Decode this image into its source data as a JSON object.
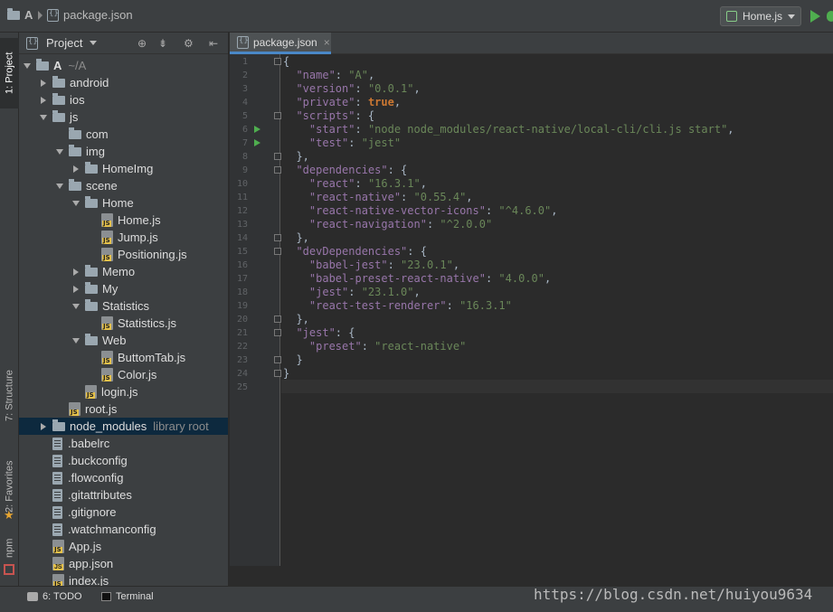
{
  "topbar": {
    "project": "A",
    "file": "package.json",
    "run_config": "Home.js"
  },
  "leftstrip": {
    "tabs": [
      "1: Project",
      "7: Structure",
      "2: Favorites",
      "npm"
    ]
  },
  "project_panel": {
    "title": "Project",
    "tree": [
      {
        "label": "A",
        "extra": "~/A",
        "type": "folder",
        "expanded": true,
        "depth": 0
      },
      {
        "label": "android",
        "type": "folder",
        "expanded": false,
        "depth": 1
      },
      {
        "label": "ios",
        "type": "folder",
        "expanded": false,
        "depth": 1
      },
      {
        "label": "js",
        "type": "folder",
        "expanded": true,
        "depth": 1
      },
      {
        "label": "com",
        "type": "folder",
        "expanded": null,
        "depth": 2
      },
      {
        "label": "img",
        "type": "folder",
        "expanded": true,
        "depth": 2
      },
      {
        "label": "HomeImg",
        "type": "folder",
        "expanded": false,
        "depth": 3
      },
      {
        "label": "scene",
        "type": "folder",
        "expanded": true,
        "depth": 2
      },
      {
        "label": "Home",
        "type": "folder",
        "expanded": true,
        "depth": 3
      },
      {
        "label": "Home.js",
        "type": "js",
        "depth": 4
      },
      {
        "label": "Jump.js",
        "type": "js",
        "depth": 4
      },
      {
        "label": "Positioning.js",
        "type": "js",
        "depth": 4
      },
      {
        "label": "Memo",
        "type": "folder",
        "expanded": false,
        "depth": 3
      },
      {
        "label": "My",
        "type": "folder",
        "expanded": false,
        "depth": 3
      },
      {
        "label": "Statistics",
        "type": "folder",
        "expanded": true,
        "depth": 3
      },
      {
        "label": "Statistics.js",
        "type": "js",
        "depth": 4
      },
      {
        "label": "Web",
        "type": "folder",
        "expanded": true,
        "depth": 3
      },
      {
        "label": "ButtomTab.js",
        "type": "js",
        "depth": 4
      },
      {
        "label": "Color.js",
        "type": "js",
        "depth": 4
      },
      {
        "label": "login.js",
        "type": "js",
        "depth": 3
      },
      {
        "label": "root.js",
        "type": "js",
        "depth": 2
      },
      {
        "label": "node_modules",
        "extra": "library root",
        "type": "folder",
        "expanded": false,
        "depth": 1,
        "selected": true
      },
      {
        "label": ".babelrc",
        "type": "txt",
        "depth": 1
      },
      {
        "label": ".buckconfig",
        "type": "txt",
        "depth": 1
      },
      {
        "label": ".flowconfig",
        "type": "txt",
        "depth": 1
      },
      {
        "label": ".gitattributes",
        "type": "txt",
        "depth": 1
      },
      {
        "label": ".gitignore",
        "type": "txt",
        "depth": 1
      },
      {
        "label": ".watchmanconfig",
        "type": "txt",
        "depth": 1
      },
      {
        "label": "App.js",
        "type": "js",
        "depth": 1
      },
      {
        "label": "app.json",
        "type": "json",
        "depth": 1
      },
      {
        "label": "index.js",
        "type": "js",
        "depth": 1
      }
    ]
  },
  "editor": {
    "tab": "package.json",
    "lines": [
      [
        [
          "p",
          "{"
        ]
      ],
      [
        [
          "k",
          "  \"name\""
        ],
        [
          "p",
          ": "
        ],
        [
          "s",
          "\"A\""
        ],
        [
          "p",
          ","
        ]
      ],
      [
        [
          "k",
          "  \"version\""
        ],
        [
          "p",
          ": "
        ],
        [
          "s",
          "\"0.0.1\""
        ],
        [
          "p",
          ","
        ]
      ],
      [
        [
          "k",
          "  \"private\""
        ],
        [
          "p",
          ": "
        ],
        [
          "b",
          "true"
        ],
        [
          "p",
          ","
        ]
      ],
      [
        [
          "k",
          "  \"scripts\""
        ],
        [
          "p",
          ": {"
        ]
      ],
      [
        [
          "k",
          "    \"start\""
        ],
        [
          "p",
          ": "
        ],
        [
          "s",
          "\"node node_modules/react-native/local-cli/cli.js start\""
        ],
        [
          "p",
          ","
        ]
      ],
      [
        [
          "k",
          "    \"test\""
        ],
        [
          "p",
          ": "
        ],
        [
          "s",
          "\"jest\""
        ]
      ],
      [
        [
          "p",
          "  },"
        ]
      ],
      [
        [
          "k",
          "  \"dependencies\""
        ],
        [
          "p",
          ": {"
        ]
      ],
      [
        [
          "k",
          "    \"react\""
        ],
        [
          "p",
          ": "
        ],
        [
          "s",
          "\"16.3.1\""
        ],
        [
          "p",
          ","
        ]
      ],
      [
        [
          "k",
          "    \"react-native\""
        ],
        [
          "p",
          ": "
        ],
        [
          "s",
          "\"0.55.4\""
        ],
        [
          "p",
          ","
        ]
      ],
      [
        [
          "k",
          "    \"react-native-vector-icons\""
        ],
        [
          "p",
          ": "
        ],
        [
          "s",
          "\"^4.6.0\""
        ],
        [
          "p",
          ","
        ]
      ],
      [
        [
          "k",
          "    \"react-navigation\""
        ],
        [
          "p",
          ": "
        ],
        [
          "s",
          "\"^2.0.0\""
        ]
      ],
      [
        [
          "p",
          "  },"
        ]
      ],
      [
        [
          "k",
          "  \"devDependencies\""
        ],
        [
          "p",
          ": {"
        ]
      ],
      [
        [
          "k",
          "    \"babel-jest\""
        ],
        [
          "p",
          ": "
        ],
        [
          "s",
          "\"23.0.1\""
        ],
        [
          "p",
          ","
        ]
      ],
      [
        [
          "k",
          "    \"babel-preset-react-native\""
        ],
        [
          "p",
          ": "
        ],
        [
          "s",
          "\"4.0.0\""
        ],
        [
          "p",
          ","
        ]
      ],
      [
        [
          "k",
          "    \"jest\""
        ],
        [
          "p",
          ": "
        ],
        [
          "s",
          "\"23.1.0\""
        ],
        [
          "p",
          ","
        ]
      ],
      [
        [
          "k",
          "    \"react-test-renderer\""
        ],
        [
          "p",
          ": "
        ],
        [
          "s",
          "\"16.3.1\""
        ]
      ],
      [
        [
          "p",
          "  },"
        ]
      ],
      [
        [
          "k",
          "  \"jest\""
        ],
        [
          "p",
          ": {"
        ]
      ],
      [
        [
          "k",
          "    \"preset\""
        ],
        [
          "p",
          ": "
        ],
        [
          "s",
          "\"react-native\""
        ]
      ],
      [
        [
          "p",
          "  }"
        ]
      ],
      [
        [
          "p",
          "}"
        ]
      ],
      []
    ]
  },
  "bottombar": {
    "todo": "6: TODO",
    "terminal": "Terminal"
  },
  "watermark": "https://blog.csdn.net/huiyou9634"
}
